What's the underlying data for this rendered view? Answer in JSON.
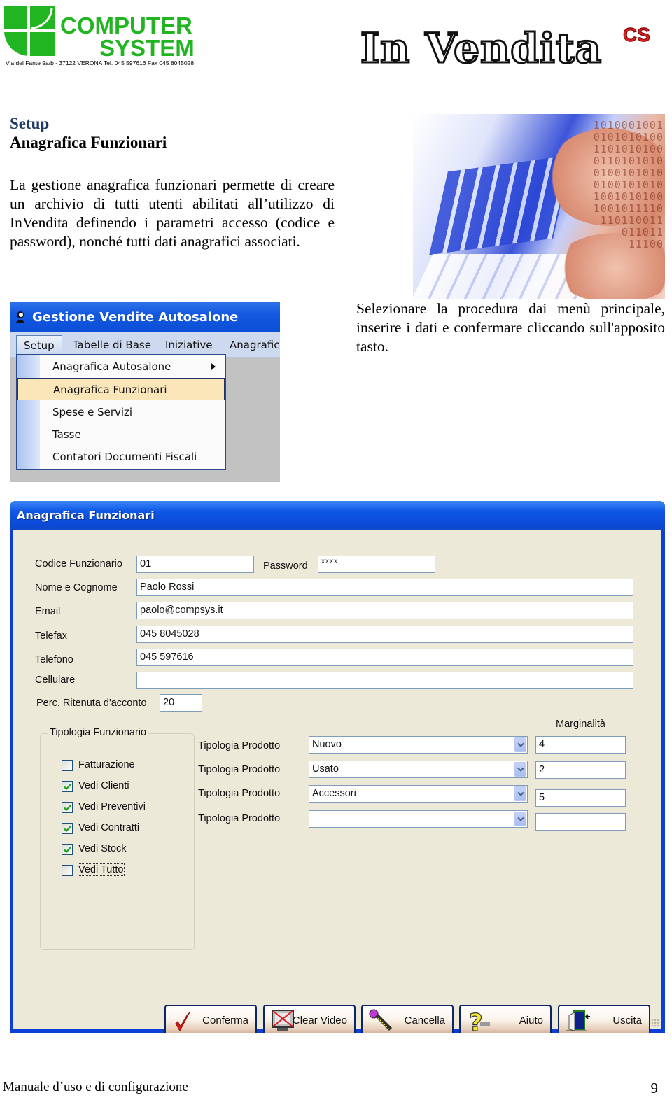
{
  "header": {
    "company_logo": {
      "line1": "COMPUTER",
      "line2": "SYSTEM",
      "address": "Via del Fante 9a/b  -  37122 VERONA    Tel. 045 597616    Fax 045 8045028",
      "brand_color": "#22b522"
    },
    "product_logo": {
      "name": "In Vendita",
      "superscript": "CS",
      "superscript_color": "#e31b1b"
    }
  },
  "content": {
    "section": "Setup",
    "title": "Anagrafica Funzionari",
    "paragraph1": "La  gestione anagrafica funzionari permette di creare un archivio di tutti utenti abilitati all’utilizzo di InVendita definendo i parametri accesso (codice e password), nonché tutti dati anagrafici associati.",
    "paragraph2": "Selezionare la procedura dai menù principale, inserire i dati e confermare cliccando sull'apposito tasto.",
    "photo_binary": [
      "1010001001",
      "0101010100",
      "1101010100",
      "0110101010",
      "0100101010",
      "0100101010",
      "1001010100",
      "1001011110",
      "110110011",
      "011011",
      "11100"
    ]
  },
  "menu_screenshot": {
    "window_title": "Gestione Vendite Autosalone",
    "menubar": [
      "Setup",
      "Tabelle di Base",
      "Iniziative",
      "Anagrafica"
    ],
    "active_menu": "Setup",
    "items": [
      {
        "label": "Anagrafica Autosalone",
        "has_submenu": true,
        "highlighted": false
      },
      {
        "label": "Anagrafica Funzionari",
        "has_submenu": false,
        "highlighted": true
      },
      {
        "label": "Spese e Servizi",
        "has_submenu": false,
        "highlighted": false
      },
      {
        "label": "Tasse",
        "has_submenu": false,
        "highlighted": false
      },
      {
        "label": "Contatori Documenti Fiscali",
        "has_submenu": false,
        "highlighted": false
      }
    ]
  },
  "dialog": {
    "title": "Anagrafica Funzionari",
    "fields": {
      "codice": {
        "label": "Codice Funzionario",
        "value": "01"
      },
      "password": {
        "label": "Password",
        "value": "xxxx"
      },
      "nome": {
        "label": "Nome e Cognome",
        "value": "Paolo Rossi"
      },
      "email": {
        "label": "Email",
        "value": "paolo@compsys.it"
      },
      "telefax": {
        "label": "Telefax",
        "value": "045 8045028"
      },
      "telefono": {
        "label": "Telefono",
        "value": "045 597616"
      },
      "cellulare": {
        "label": "Cellulare",
        "value": ""
      },
      "ritenuta": {
        "label": "Perc. Ritenuta d'acconto",
        "value": "20"
      }
    },
    "group_title": "Tipologia Funzionario",
    "checkboxes": [
      {
        "label": "Fatturazione",
        "checked": false
      },
      {
        "label": "Vedi Clienti",
        "checked": true
      },
      {
        "label": "Vedi Preventivi",
        "checked": true
      },
      {
        "label": "Vedi Contratti",
        "checked": true
      },
      {
        "label": "Vedi Stock",
        "checked": true
      },
      {
        "label": "Vedi Tutto",
        "checked": false
      }
    ],
    "margin_header": "Marginalità",
    "product_rows": [
      {
        "label": "Tipologia Prodotto",
        "selected": "Nuovo",
        "margin": "4"
      },
      {
        "label": "Tipologia Prodotto",
        "selected": "Usato",
        "margin": "2"
      },
      {
        "label": "Tipologia Prodotto",
        "selected": "Accessori",
        "margin": "5"
      },
      {
        "label": "Tipologia Prodotto",
        "selected": "",
        "margin": ""
      }
    ],
    "buttons": [
      {
        "label": "Conferma",
        "icon": "checkmark-icon"
      },
      {
        "label": "Clear Video",
        "icon": "clear-screen-icon"
      },
      {
        "label": "Cancella",
        "icon": "eraser-icon"
      },
      {
        "label": "Aiuto",
        "icon": "help-icon"
      },
      {
        "label": "Uscita",
        "icon": "exit-door-icon"
      }
    ]
  },
  "footer": {
    "title": "Manuale d’uso e di configurazione",
    "page_number": "9"
  }
}
